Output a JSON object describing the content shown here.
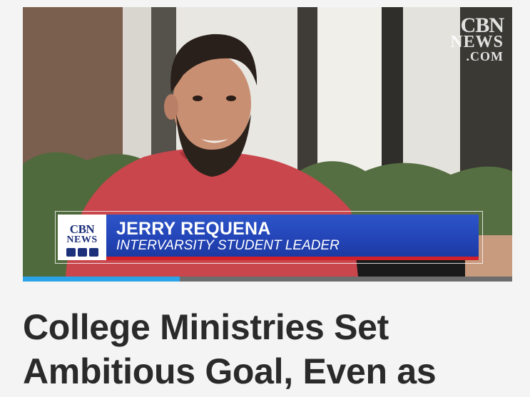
{
  "video": {
    "watermark": {
      "line1": "CBN",
      "line2": "NEWS",
      "line3": ".COM"
    },
    "lower_third": {
      "logo_line1": "CBN",
      "logo_line2": "NEWS",
      "name": "JERRY REQUENA",
      "title": "INTERVARSITY STUDENT LEADER"
    },
    "playback_progress": 0.32
  },
  "article": {
    "headline_line1": "College Ministries Set",
    "headline_line2": "Ambitious Goal, Even as"
  },
  "colors": {
    "lower_third_blue": "#2345b8",
    "lower_third_red": "#d1202a",
    "progress_fill": "#2aa3e8",
    "headline_text": "#2a2a2a"
  },
  "icons": [
    "youtube-icon",
    "instagram-icon",
    "facebook-icon"
  ]
}
